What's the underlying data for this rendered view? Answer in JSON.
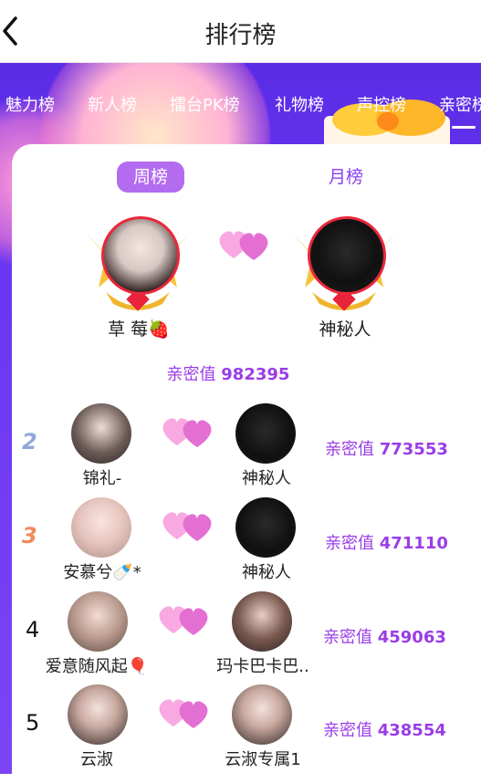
{
  "header": {
    "title": "排行榜"
  },
  "tabs": [
    "魅力榜",
    "新人榜",
    "擂台PK榜",
    "礼物榜",
    "声控榜",
    "亲密榜"
  ],
  "period": {
    "week": "周榜",
    "month": "月榜"
  },
  "top": {
    "left_name": "草 莓🍓",
    "right_name": "神秘人",
    "score_label": "亲密值",
    "score": "982395"
  },
  "rows": [
    {
      "rank": "2",
      "left": "锦礼-",
      "right": "神秘人",
      "label": "亲密值",
      "score": "773553"
    },
    {
      "rank": "3",
      "left": "安慕兮🍼*",
      "right": "神秘人",
      "label": "亲密值",
      "score": "471110"
    },
    {
      "rank": "4",
      "left": "爱意随风起🎈",
      "right": "玛卡巴卡巴..",
      "label": "亲密值",
      "score": "459063"
    },
    {
      "rank": "5",
      "left": "云淑",
      "right": "云淑专属1",
      "label": "亲密值",
      "score": "438554"
    }
  ],
  "colors": {
    "accent": "#9a3ce8",
    "banner": "#5a2ce6",
    "rank2": "#8fa6d9",
    "rank3": "#f08a5d"
  },
  "icons": [
    "back-arrow-icon",
    "heart-couple-icon",
    "crown-frame-icon",
    "gift-box-icon"
  ]
}
